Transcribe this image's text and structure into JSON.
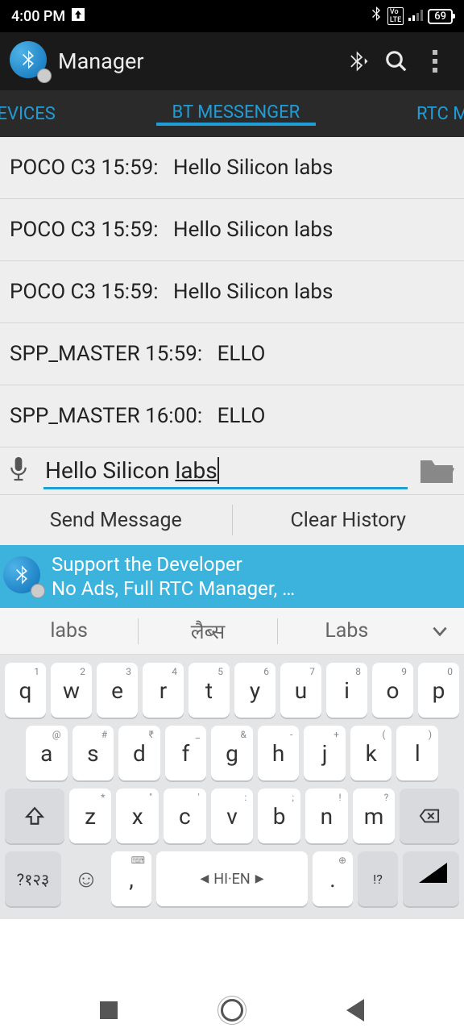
{
  "status": {
    "time": "4:00 PM",
    "battery": "69"
  },
  "header": {
    "title": "Manager"
  },
  "tabs": {
    "left": "DEVICES",
    "center": "BT MESSENGER",
    "right": "RTC MA"
  },
  "messages": [
    {
      "device": "POCO C3",
      "time": "15:59",
      "text": "Hello Silicon labs"
    },
    {
      "device": "POCO C3",
      "time": "15:59",
      "text": "Hello Silicon labs"
    },
    {
      "device": "POCO C3",
      "time": "15:59",
      "text": "Hello Silicon labs"
    },
    {
      "device": "SPP_MASTER",
      "time": "15:59",
      "text": "ELLO"
    },
    {
      "device": "SPP_MASTER",
      "time": "16:00",
      "text": "ELLO"
    }
  ],
  "input": {
    "value_pre": "Hello Silicon ",
    "value_underlined": "labs"
  },
  "actions": {
    "send": "Send Message",
    "clear": "Clear History"
  },
  "promo": {
    "line1": "Support the Developer",
    "line2": "No Ads, Full RTC Manager, …"
  },
  "suggestions": {
    "a": "labs",
    "b": "लैब्स",
    "c": "Labs"
  },
  "keyboard": {
    "row1": [
      {
        "k": "q",
        "s": "1"
      },
      {
        "k": "w",
        "s": "2"
      },
      {
        "k": "e",
        "s": "3"
      },
      {
        "k": "r",
        "s": "4"
      },
      {
        "k": "t",
        "s": "5"
      },
      {
        "k": "y",
        "s": "6"
      },
      {
        "k": "u",
        "s": "7"
      },
      {
        "k": "i",
        "s": "8"
      },
      {
        "k": "o",
        "s": "9"
      },
      {
        "k": "p",
        "s": "0"
      }
    ],
    "row2": [
      {
        "k": "a",
        "s": "@"
      },
      {
        "k": "s",
        "s": "#"
      },
      {
        "k": "d",
        "s": "₹"
      },
      {
        "k": "f",
        "s": "_"
      },
      {
        "k": "g",
        "s": "&"
      },
      {
        "k": "h",
        "s": "-"
      },
      {
        "k": "j",
        "s": "+"
      },
      {
        "k": "k",
        "s": "("
      },
      {
        "k": "l",
        "s": ")"
      }
    ],
    "row3": [
      {
        "k": "z",
        "s": "*"
      },
      {
        "k": "x",
        "s": "\""
      },
      {
        "k": "c",
        "s": "'"
      },
      {
        "k": "v",
        "s": ":"
      },
      {
        "k": "b",
        "s": ";"
      },
      {
        "k": "n",
        "s": "!"
      },
      {
        "k": "m",
        "s": "?"
      }
    ],
    "symkey": "?१२३",
    "comma_sup": "⌨",
    "space_label": "HI·EN",
    "dot_sup": "⊕",
    "punct_label": "!?"
  }
}
